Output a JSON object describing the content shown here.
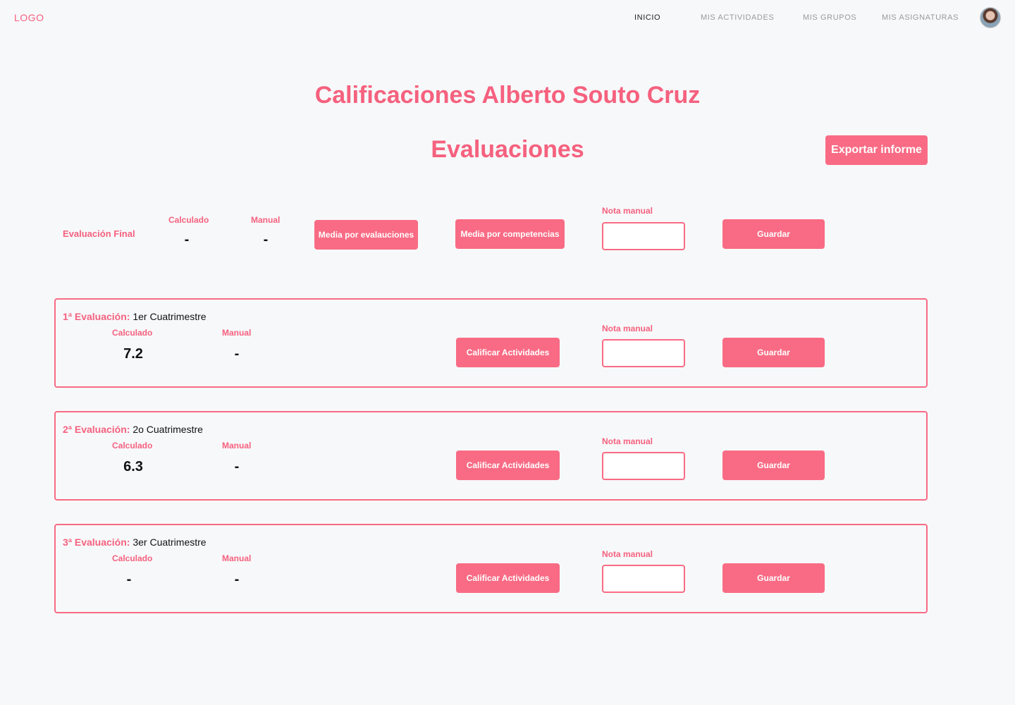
{
  "nav": {
    "logo": "LOGO",
    "items": [
      {
        "label": "INICIO",
        "active": true
      },
      {
        "label": "MIS ACTIVIDADES",
        "active": false
      },
      {
        "label": "MIS GRUPOS",
        "active": false
      },
      {
        "label": "MIS ASIGNATURAS",
        "active": false
      }
    ],
    "avatar_icon": "user-avatar"
  },
  "page": {
    "title": "Calificaciones Alberto Souto Cruz",
    "subtitle": "Evaluaciones",
    "export_label": "Exportar informe"
  },
  "final": {
    "label": "Evaluación Final",
    "calculado_label": "Calculado",
    "calculado_value": "-",
    "manual_label": "Manual",
    "manual_value": "-",
    "media_evaluaciones_label": "Media por evalauciones",
    "media_competencias_label": "Media por competencias",
    "nota_manual_label": "Nota manual",
    "nota_manual_value": "",
    "save_label": "Guardar"
  },
  "evaluations": [
    {
      "prefix": "1ª Evaluación:",
      "name": "1er Cuatrimestre",
      "calculado_label": "Calculado",
      "calculado_value": "7.2",
      "manual_label": "Manual",
      "manual_value": "-",
      "action_label": "Calificar Actividades",
      "nota_manual_label": "Nota manual",
      "nota_manual_value": "",
      "save_label": "Guardar"
    },
    {
      "prefix": "2ª Evaluación:",
      "name": "2o Cuatrimestre",
      "calculado_label": "Calculado",
      "calculado_value": "6.3",
      "manual_label": "Manual",
      "manual_value": "-",
      "action_label": "Calificar Actividades",
      "nota_manual_label": "Nota manual",
      "nota_manual_value": "",
      "save_label": "Guardar"
    },
    {
      "prefix": "3ª Evaluación:",
      "name": "3er Cuatrimestre",
      "calculado_label": "Calculado",
      "calculado_value": "-",
      "manual_label": "Manual",
      "manual_value": "-",
      "action_label": "Calificar Actividades",
      "nota_manual_label": "Nota manual",
      "nota_manual_value": "",
      "save_label": "Guardar"
    }
  ],
  "colors": {
    "accent": "#f96b84",
    "accent_text": "#f5617e",
    "background": "#f7f8fa"
  }
}
